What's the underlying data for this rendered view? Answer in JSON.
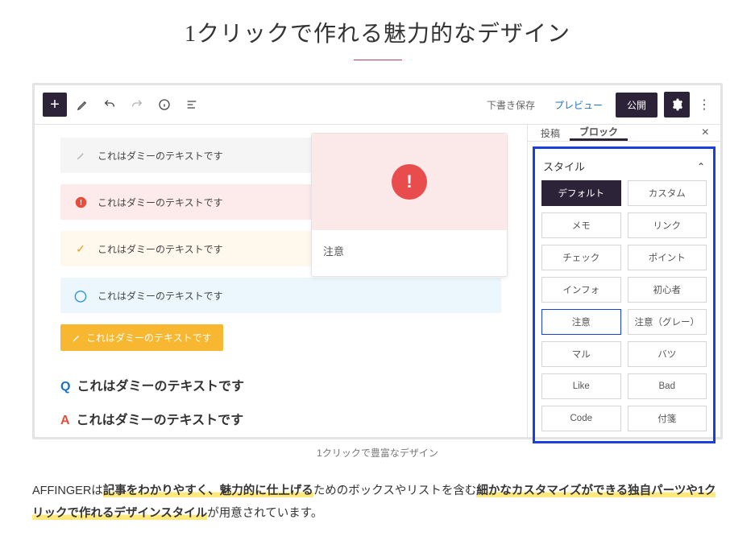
{
  "heading": "1クリックで作れる魅力的なデザイン",
  "toolbar": {
    "save_draft": "下書き保存",
    "preview": "プレビュー",
    "publish": "公開"
  },
  "rows": {
    "r1": "これはダミーのテキストです",
    "r2": "これはダミーのテキストです",
    "r3": "これはダミーのテキストです",
    "r4": "これはダミーのテキストです",
    "r5": "これはダミーのテキストです",
    "q": "これはダミーのテキストです",
    "a": "これはダミーのテキストです"
  },
  "qa": {
    "q": "Q",
    "a": "A"
  },
  "popover": {
    "label": "注意",
    "bang": "!"
  },
  "sidebar": {
    "tabs": {
      "post": "投稿",
      "block": "ブロック"
    },
    "style_title": "スタイル",
    "styles": [
      "デフォルト",
      "カスタム",
      "メモ",
      "リンク",
      "チェック",
      "ポイント",
      "インフォ",
      "初心者",
      "注意",
      "注意（グレー）",
      "マル",
      "バツ",
      "Like",
      "Bad",
      "Code",
      "付箋"
    ]
  },
  "caption": "1クリックで豊富なデザイン",
  "desc": {
    "lead": "AFFINGERは",
    "hl1": "記事をわかりやすく、魅力的に仕上げる",
    "mid": "ためのボックスやリストを含む",
    "hl2": "細かなカスタマイズができる独自パーツや1クリックで作れるデザインスタイル",
    "tail": "が用意されています。"
  }
}
